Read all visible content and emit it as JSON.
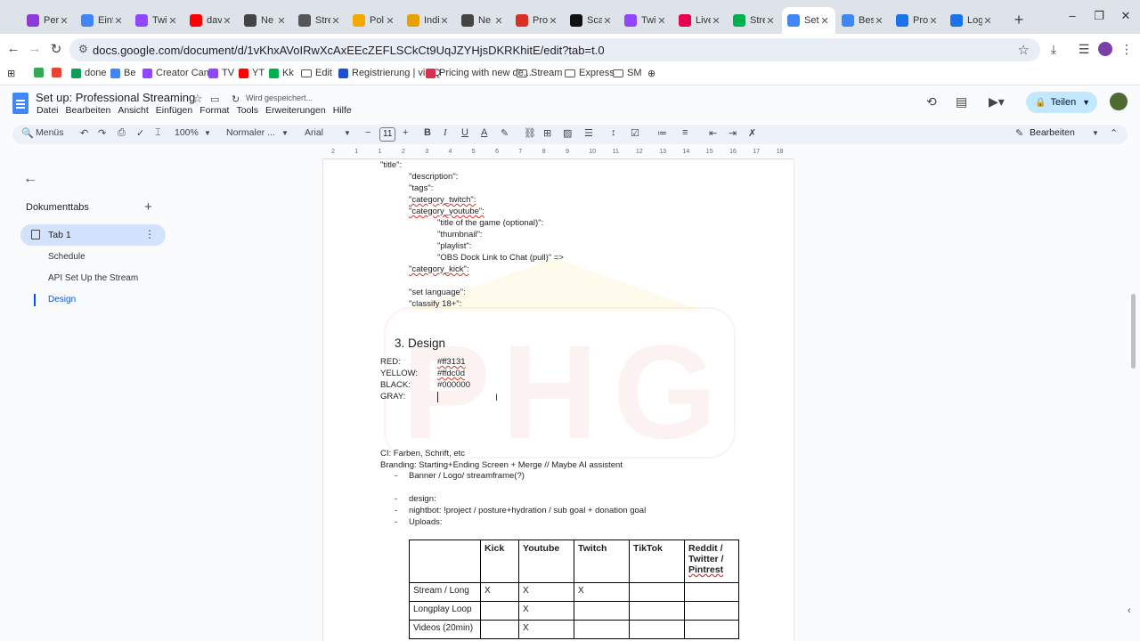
{
  "browser": {
    "tabs": [
      {
        "label": "Pers",
        "color": "#8e3ad6"
      },
      {
        "label": "Einf",
        "color": "#4285f4"
      },
      {
        "label": "Twi",
        "color": "#9146ff"
      },
      {
        "label": "dav",
        "color": "#ff0000"
      },
      {
        "label": "Ne",
        "color": "#444444"
      },
      {
        "label": "Stre",
        "color": "#555555"
      },
      {
        "label": "Pol",
        "color": "#f2a900"
      },
      {
        "label": "Indi",
        "color": "#e6a100"
      },
      {
        "label": "Ne",
        "color": "#444444"
      },
      {
        "label": "Pro",
        "color": "#d93025"
      },
      {
        "label": "Sca",
        "color": "#111111"
      },
      {
        "label": "Twi",
        "color": "#9146ff"
      },
      {
        "label": "Live",
        "color": "#e6004c"
      },
      {
        "label": "Stre",
        "color": "#00b050"
      },
      {
        "label": "Set",
        "color": "#4285f4"
      },
      {
        "label": "Bes",
        "color": "#4285f4"
      },
      {
        "label": "Proj",
        "color": "#1a73e8"
      },
      {
        "label": "Log",
        "color": "#1a73e8"
      }
    ],
    "active_tab": 14,
    "url": "docs.google.com/document/d/1vKhxAVoIRwXcAxEEcZEFLSCkCt9UqJZYHjsDKRKhitE/edit?tab=t.0",
    "bookmarks": [
      {
        "label": "",
        "type": "app",
        "color": "#34a853"
      },
      {
        "label": "",
        "type": "app",
        "color": "#ea4335"
      },
      {
        "label": "done",
        "type": "app",
        "color": "#0f9d58"
      },
      {
        "label": "Be",
        "type": "app",
        "color": "#4285f4"
      },
      {
        "label": "Creator Camp",
        "type": "app",
        "color": "#9146ff"
      },
      {
        "label": "TV",
        "type": "app",
        "color": "#9146ff"
      },
      {
        "label": "YT",
        "type": "app",
        "color": "#ff0000"
      },
      {
        "label": "Kk",
        "type": "app",
        "color": "#00b050"
      },
      {
        "label": "Edit",
        "type": "folder"
      },
      {
        "label": "Registrierung | vidIQ",
        "type": "app",
        "color": "#1a4fd6"
      },
      {
        "label": "Pricing with new de...",
        "type": "app",
        "color": "#d9304f"
      },
      {
        "label": "Stream",
        "type": "folder"
      },
      {
        "label": "Express",
        "type": "folder"
      },
      {
        "label": "SM",
        "type": "folder"
      }
    ]
  },
  "doc": {
    "title": "Set up: Professional Streaming",
    "saving": "Wird gespeichert...",
    "menu": [
      "Datei",
      "Bearbeiten",
      "Ansicht",
      "Einfügen",
      "Format",
      "Tools",
      "Erweiterungen",
      "Hilfe"
    ],
    "share_label": "Teilen",
    "toolbar": {
      "menus_label": "Menüs",
      "zoom": "100%",
      "style": "Normaler ...",
      "font": "Arial",
      "font_size": "11",
      "edit_mode": "Bearbeiten"
    }
  },
  "sidebar": {
    "heading": "Dokumenttabs",
    "tab": "Tab 1",
    "outline": [
      "Schedule",
      "API Set Up the Stream",
      "Design"
    ],
    "active_outline": 2
  },
  "ruler": [
    "2",
    "1",
    "1",
    "2",
    "3",
    "4",
    "5",
    "6",
    "7",
    "8",
    "9",
    "10",
    "11",
    "12",
    "13",
    "14",
    "15",
    "16",
    "17",
    "18"
  ],
  "content": {
    "lines_top": [
      {
        "text": "\"title\":",
        "indent": 0,
        "ul": false
      },
      {
        "text": "\"description\":",
        "indent": 1,
        "ul": false
      },
      {
        "text": "\"tags\":",
        "indent": 1,
        "ul": false
      },
      {
        "text": "\"category_twitch\":",
        "indent": 1,
        "ul": true
      },
      {
        "text": "\"category_youtube\":",
        "indent": 1,
        "ul": true
      },
      {
        "text": "\"title of the game (optional)\":",
        "indent": 2,
        "ul": false
      },
      {
        "text": "\"thumbnail\":",
        "indent": 2,
        "ul": false
      },
      {
        "text": "\"playlist\":",
        "indent": 2,
        "ul": false
      },
      {
        "text": "\"OBS Dock Link to Chat (pull)\" =>",
        "indent": 2,
        "ul": false
      },
      {
        "text": "\"category_kick\":",
        "indent": 1,
        "ul": true
      },
      {
        "text": "",
        "indent": 1,
        "ul": false
      },
      {
        "text": "\"set language\":",
        "indent": 1,
        "ul": false
      },
      {
        "text": "\"classify 18+\":",
        "indent": 1,
        "ul": false
      }
    ],
    "heading": "3. Design",
    "colors": [
      {
        "name": "RED:",
        "value": "#ff3131"
      },
      {
        "name": "YELLOW:",
        "value": "#ffdc0d"
      },
      {
        "name": "BLACK:",
        "value": "#000000"
      },
      {
        "name": "GRAY:",
        "value": ""
      }
    ],
    "ci_line": "CI: Farben, Schrift, etc",
    "branding_line": "Branding: Starting+Ending Screen + Merge // Maybe AI assistent",
    "bullets": [
      "Banner / Logo/ streamframe(?)",
      "",
      "design:",
      "nightbot: !project / posture+hydration / sub goal + donation goal",
      "Uploads:"
    ],
    "table": {
      "headers": [
        "",
        "Kick",
        "Youtube",
        "Twitch",
        "TikTok",
        "Reddit / Twitter / Pintrest"
      ],
      "rows": [
        [
          "Stream / Long",
          "X",
          "X",
          "X",
          "",
          ""
        ],
        [
          "Longplay Loop",
          "",
          "X",
          "",
          "",
          ""
        ],
        [
          "Videos (20min)",
          "",
          "X",
          "",
          "",
          ""
        ]
      ]
    },
    "watermark": [
      "P",
      "H",
      "G"
    ]
  }
}
